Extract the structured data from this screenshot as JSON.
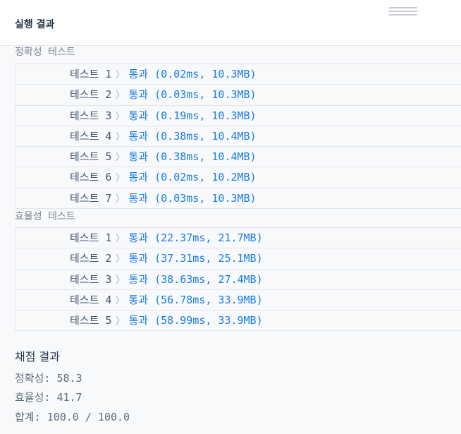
{
  "header": {
    "title": "실행 결과"
  },
  "accuracy": {
    "heading": "정확성  테스트",
    "rows": [
      {
        "label": "테스트 1",
        "result": "통과 (0.02ms, 10.3MB)"
      },
      {
        "label": "테스트 2",
        "result": "통과 (0.03ms, 10.3MB)"
      },
      {
        "label": "테스트 3",
        "result": "통과 (0.19ms, 10.3MB)"
      },
      {
        "label": "테스트 4",
        "result": "통과 (0.38ms, 10.4MB)"
      },
      {
        "label": "테스트 5",
        "result": "통과 (0.38ms, 10.4MB)"
      },
      {
        "label": "테스트 6",
        "result": "통과 (0.02ms, 10.2MB)"
      },
      {
        "label": "테스트 7",
        "result": "통과 (0.03ms, 10.3MB)"
      }
    ]
  },
  "efficiency": {
    "heading": "효율성  테스트",
    "rows": [
      {
        "label": "테스트 1",
        "result": "통과 (22.37ms, 21.7MB)"
      },
      {
        "label": "테스트 2",
        "result": "통과 (37.31ms, 25.1MB)"
      },
      {
        "label": "테스트 3",
        "result": "통과 (38.63ms, 27.4MB)"
      },
      {
        "label": "테스트 4",
        "result": "통과 (56.78ms, 33.9MB)"
      },
      {
        "label": "테스트 5",
        "result": "통과 (58.99ms, 33.9MB)"
      }
    ]
  },
  "scoring": {
    "title": "채점 결과",
    "accuracy": "정확성: 58.3",
    "efficiency": "효율성: 41.7",
    "total": "합계: 100.0 / 100.0"
  },
  "icons": {
    "chevron": "chevron-right-icon",
    "handle": "drag-handle-icon"
  },
  "colors": {
    "pass": "#1a7ce6",
    "label": "#44576c",
    "muted": "#7b8592"
  }
}
